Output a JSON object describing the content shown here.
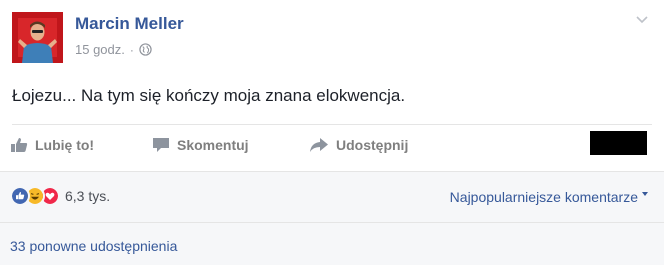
{
  "post": {
    "author": "Marcin Meller",
    "time": "15 godz.",
    "separator": "·",
    "text": "Łojezu... Na tym się kończy moja znana elokwencja."
  },
  "actions": {
    "like": "Lubię to!",
    "comment": "Skomentuj",
    "share": "Udostępnij"
  },
  "reactions": {
    "types": [
      "like-icon",
      "haha-icon",
      "love-icon"
    ],
    "count": "6,3 tys."
  },
  "comments": {
    "sort_label": "Najpopularniejsze komentarze"
  },
  "shares": {
    "label": "33 ponowne udostępnienia"
  },
  "colors": {
    "link": "#365899",
    "action_gray": "#7f7f7f",
    "like_blue": "#4267b2",
    "haha_yellow": "#f7b928",
    "love_red": "#f0284a",
    "avatar_red": "#c0161b"
  }
}
